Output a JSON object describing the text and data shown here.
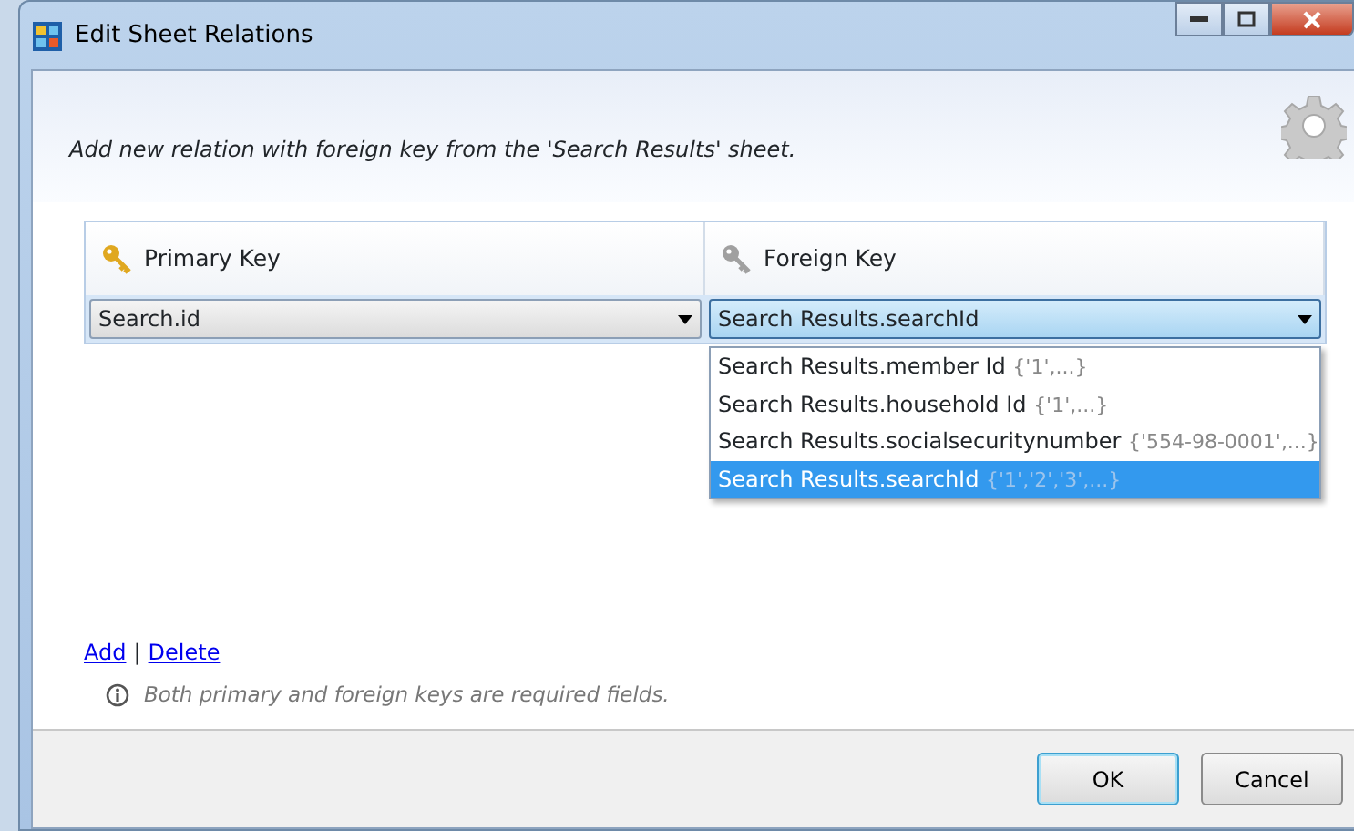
{
  "window": {
    "title": "Edit Sheet Relations"
  },
  "instruction": "Add new relation with foreign key from the 'Search Results' sheet.",
  "table": {
    "columns": [
      {
        "label": "Primary Key",
        "kind": "primary"
      },
      {
        "label": "Foreign Key",
        "kind": "foreign"
      }
    ],
    "row": {
      "primary": "Search.id",
      "foreign": "Search Results.searchId"
    }
  },
  "dropdown": {
    "expanded": true,
    "options": [
      {
        "label": "Search Results.member Id",
        "hint": "{'1',...}",
        "selected": false
      },
      {
        "label": "Search Results.household Id",
        "hint": "{'1',...}",
        "selected": false
      },
      {
        "label": "Search Results.socialsecuritynumber",
        "hint": "{'554-98-0001',...}",
        "selected": false
      },
      {
        "label": "Search Results.searchId",
        "hint": "{'1','2','3',...}",
        "selected": true
      }
    ]
  },
  "links": [
    "Add",
    "Delete"
  ],
  "link_separator": "|",
  "info": "Both primary and foreign keys are required fields.",
  "buttons": [
    {
      "label": "OK",
      "default": true
    },
    {
      "label": "Cancel",
      "default": false
    }
  ]
}
